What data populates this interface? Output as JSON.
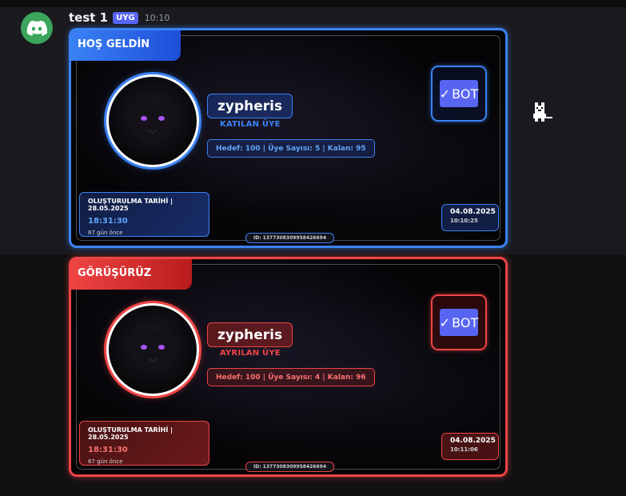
{
  "message": {
    "author": "test 1",
    "app_tag": "UYG",
    "timestamp": "10:10"
  },
  "welcome_card": {
    "title": "HOŞ GELDİN",
    "username": "zypheris",
    "action_label": "KATILAN ÜYE",
    "stats": "Hedef: 100 | Üye Sayısı: 5 | Kalan: 95",
    "bot_badge": "BOT",
    "created_title": "OLUŞTURULMA TARİHİ | 28.05.2025",
    "created_time": "18:31:30",
    "created_ago": "67 gün önce",
    "date": "04.08.2025",
    "time": "10:10:25",
    "id_text": "ID: 1377308309958426694",
    "accent": "#3b82f6"
  },
  "goodbye_card": {
    "title": "GÖRÜŞÜRÜZ",
    "username": "zypheris",
    "action_label": "AYRILAN ÜYE",
    "stats": "Hedef: 100 | Üye Sayısı: 4 | Kalan: 96",
    "bot_badge": "BOT",
    "created_title": "OLUŞTURULMA TARİHİ | 28.05.2025",
    "created_time": "18:31:30",
    "created_ago": "67 gün önce",
    "date": "04.08.2025",
    "time": "10:11:06",
    "id_text": "ID: 1377308309958426694",
    "accent": "#ef4444"
  },
  "icons": {
    "avatar": "discord-logo-icon",
    "bot_check": "checkmark-icon",
    "side": "pixel-cat-icon"
  }
}
